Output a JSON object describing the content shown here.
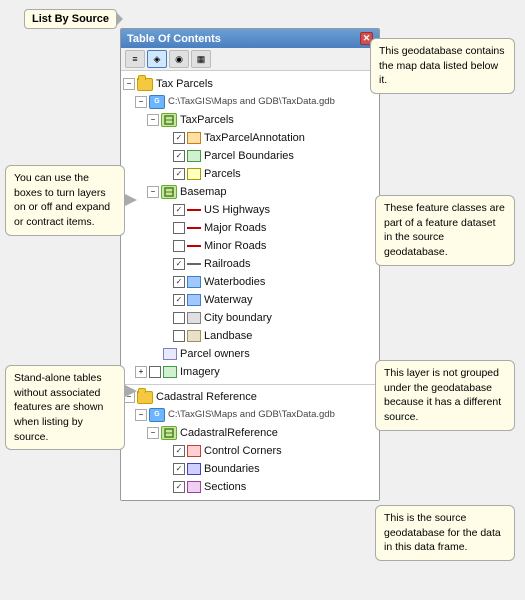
{
  "callouts": {
    "list_by_source": "List By Source",
    "geodatabase_info": "This geodatabase contains the map data listed below it.",
    "checkboxes_info": "You can use the boxes to turn layers on or off and expand or contract items.",
    "feature_classes_info": "These feature classes are part of a feature dataset in the source geodatabase.",
    "standalone_tables_info": "Stand-alone tables without associated features are shown when listing by source.",
    "different_source_info": "This layer is not grouped under the geodatabase because it has a different source.",
    "source_geodatabase_info": "This is the source geodatabase for the data in this data frame."
  },
  "toc": {
    "title": "Table Of Contents",
    "close_btn": "✕",
    "toolbar_icons": [
      "list",
      "layer",
      "source",
      "options"
    ],
    "groups": [
      {
        "name": "Tax Parcels",
        "type": "group_layer",
        "children": [
          {
            "name": "C:\\TaxGIS\\Maps and GDB\\TaxData.gdb",
            "type": "geodatabase",
            "children": [
              {
                "name": "TaxParcels",
                "type": "feature_dataset",
                "children": [
                  {
                    "name": "TaxParcelAnnotation",
                    "type": "layer_poly",
                    "checked": true
                  },
                  {
                    "name": "Parcel Boundaries",
                    "type": "layer_poly",
                    "checked": true
                  },
                  {
                    "name": "Parcels",
                    "type": "layer_poly",
                    "checked": true
                  }
                ]
              },
              {
                "name": "Basemap",
                "type": "feature_dataset",
                "children": [
                  {
                    "name": "US Highways",
                    "type": "layer_line",
                    "checked": true
                  },
                  {
                    "name": "Major Roads",
                    "type": "layer_line",
                    "checked": false
                  },
                  {
                    "name": "Minor Roads",
                    "type": "layer_line",
                    "checked": false
                  },
                  {
                    "name": "Railroads",
                    "type": "layer_rail",
                    "checked": true
                  },
                  {
                    "name": "Waterbodies",
                    "type": "layer_water",
                    "checked": true
                  },
                  {
                    "name": "Waterway",
                    "type": "layer_water",
                    "checked": true
                  },
                  {
                    "name": "City boundary",
                    "type": "layer_city",
                    "checked": false
                  },
                  {
                    "name": "Landbase",
                    "type": "layer_poly",
                    "checked": false
                  }
                ]
              }
            ]
          },
          {
            "name": "Parcel owners",
            "type": "table",
            "checked": false
          },
          {
            "name": "Imagery",
            "type": "layer_imagery",
            "checked": false
          }
        ]
      },
      {
        "name": "Cadastral Reference",
        "type": "group_layer",
        "children": [
          {
            "name": "C:\\TaxGIS\\Maps and GDB\\TaxData.gdb",
            "type": "geodatabase",
            "children": [
              {
                "name": "CadastralReference",
                "type": "feature_dataset",
                "children": [
                  {
                    "name": "Control Corners",
                    "type": "layer_poly",
                    "checked": true
                  },
                  {
                    "name": "Boundaries",
                    "type": "layer_poly",
                    "checked": true
                  },
                  {
                    "name": "Sections",
                    "type": "layer_poly",
                    "checked": true
                  }
                ]
              }
            ]
          }
        ]
      }
    ]
  }
}
